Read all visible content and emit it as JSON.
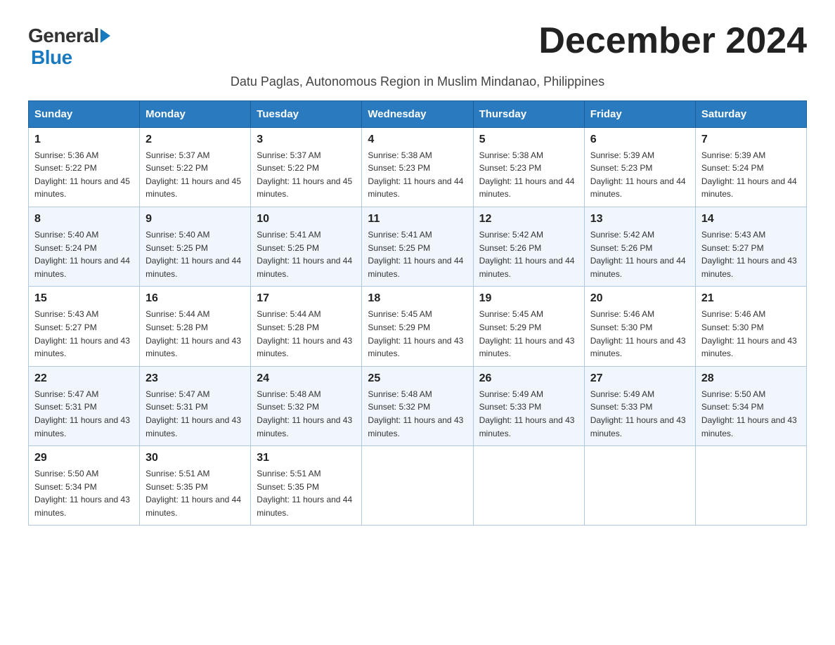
{
  "logo": {
    "text_general": "General",
    "text_blue": "Blue",
    "triangle_symbol": "▶"
  },
  "title": "December 2024",
  "subtitle": "Datu Paglas, Autonomous Region in Muslim Mindanao, Philippines",
  "days_of_week": [
    "Sunday",
    "Monday",
    "Tuesday",
    "Wednesday",
    "Thursday",
    "Friday",
    "Saturday"
  ],
  "weeks": [
    [
      {
        "day": "1",
        "sunrise": "5:36 AM",
        "sunset": "5:22 PM",
        "daylight": "11 hours and 45 minutes."
      },
      {
        "day": "2",
        "sunrise": "5:37 AM",
        "sunset": "5:22 PM",
        "daylight": "11 hours and 45 minutes."
      },
      {
        "day": "3",
        "sunrise": "5:37 AM",
        "sunset": "5:22 PM",
        "daylight": "11 hours and 45 minutes."
      },
      {
        "day": "4",
        "sunrise": "5:38 AM",
        "sunset": "5:23 PM",
        "daylight": "11 hours and 44 minutes."
      },
      {
        "day": "5",
        "sunrise": "5:38 AM",
        "sunset": "5:23 PM",
        "daylight": "11 hours and 44 minutes."
      },
      {
        "day": "6",
        "sunrise": "5:39 AM",
        "sunset": "5:23 PM",
        "daylight": "11 hours and 44 minutes."
      },
      {
        "day": "7",
        "sunrise": "5:39 AM",
        "sunset": "5:24 PM",
        "daylight": "11 hours and 44 minutes."
      }
    ],
    [
      {
        "day": "8",
        "sunrise": "5:40 AM",
        "sunset": "5:24 PM",
        "daylight": "11 hours and 44 minutes."
      },
      {
        "day": "9",
        "sunrise": "5:40 AM",
        "sunset": "5:25 PM",
        "daylight": "11 hours and 44 minutes."
      },
      {
        "day": "10",
        "sunrise": "5:41 AM",
        "sunset": "5:25 PM",
        "daylight": "11 hours and 44 minutes."
      },
      {
        "day": "11",
        "sunrise": "5:41 AM",
        "sunset": "5:25 PM",
        "daylight": "11 hours and 44 minutes."
      },
      {
        "day": "12",
        "sunrise": "5:42 AM",
        "sunset": "5:26 PM",
        "daylight": "11 hours and 44 minutes."
      },
      {
        "day": "13",
        "sunrise": "5:42 AM",
        "sunset": "5:26 PM",
        "daylight": "11 hours and 44 minutes."
      },
      {
        "day": "14",
        "sunrise": "5:43 AM",
        "sunset": "5:27 PM",
        "daylight": "11 hours and 43 minutes."
      }
    ],
    [
      {
        "day": "15",
        "sunrise": "5:43 AM",
        "sunset": "5:27 PM",
        "daylight": "11 hours and 43 minutes."
      },
      {
        "day": "16",
        "sunrise": "5:44 AM",
        "sunset": "5:28 PM",
        "daylight": "11 hours and 43 minutes."
      },
      {
        "day": "17",
        "sunrise": "5:44 AM",
        "sunset": "5:28 PM",
        "daylight": "11 hours and 43 minutes."
      },
      {
        "day": "18",
        "sunrise": "5:45 AM",
        "sunset": "5:29 PM",
        "daylight": "11 hours and 43 minutes."
      },
      {
        "day": "19",
        "sunrise": "5:45 AM",
        "sunset": "5:29 PM",
        "daylight": "11 hours and 43 minutes."
      },
      {
        "day": "20",
        "sunrise": "5:46 AM",
        "sunset": "5:30 PM",
        "daylight": "11 hours and 43 minutes."
      },
      {
        "day": "21",
        "sunrise": "5:46 AM",
        "sunset": "5:30 PM",
        "daylight": "11 hours and 43 minutes."
      }
    ],
    [
      {
        "day": "22",
        "sunrise": "5:47 AM",
        "sunset": "5:31 PM",
        "daylight": "11 hours and 43 minutes."
      },
      {
        "day": "23",
        "sunrise": "5:47 AM",
        "sunset": "5:31 PM",
        "daylight": "11 hours and 43 minutes."
      },
      {
        "day": "24",
        "sunrise": "5:48 AM",
        "sunset": "5:32 PM",
        "daylight": "11 hours and 43 minutes."
      },
      {
        "day": "25",
        "sunrise": "5:48 AM",
        "sunset": "5:32 PM",
        "daylight": "11 hours and 43 minutes."
      },
      {
        "day": "26",
        "sunrise": "5:49 AM",
        "sunset": "5:33 PM",
        "daylight": "11 hours and 43 minutes."
      },
      {
        "day": "27",
        "sunrise": "5:49 AM",
        "sunset": "5:33 PM",
        "daylight": "11 hours and 43 minutes."
      },
      {
        "day": "28",
        "sunrise": "5:50 AM",
        "sunset": "5:34 PM",
        "daylight": "11 hours and 43 minutes."
      }
    ],
    [
      {
        "day": "29",
        "sunrise": "5:50 AM",
        "sunset": "5:34 PM",
        "daylight": "11 hours and 43 minutes."
      },
      {
        "day": "30",
        "sunrise": "5:51 AM",
        "sunset": "5:35 PM",
        "daylight": "11 hours and 44 minutes."
      },
      {
        "day": "31",
        "sunrise": "5:51 AM",
        "sunset": "5:35 PM",
        "daylight": "11 hours and 44 minutes."
      },
      null,
      null,
      null,
      null
    ]
  ],
  "labels": {
    "sunrise": "Sunrise:",
    "sunset": "Sunset:",
    "daylight": "Daylight:"
  }
}
